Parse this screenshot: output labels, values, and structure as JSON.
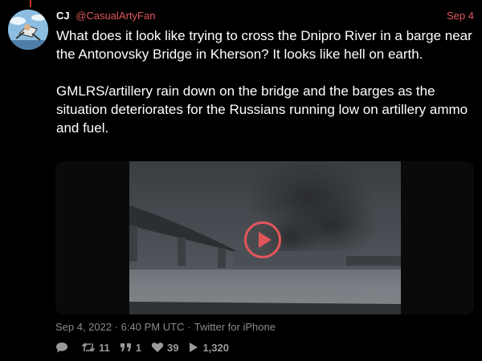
{
  "tweet": {
    "author_name": "CJ",
    "handle": "@CasualArtyFan",
    "date": "Sep 4",
    "text": "What does it look like trying to cross the Dnipro River in a barge near the Antonovsky Bridge in Kherson? It looks like hell on earth.\n\nGMLRS/artillery rain down on the bridge and the barges as the situation deteriorates for the Russians running low on artillery ammo and fuel.",
    "timestamp": "Sep 4, 2022 · 6:40 PM UTC",
    "source": "Twitter for iPhone"
  },
  "media": {
    "type": "video",
    "play_icon": "play-icon"
  },
  "stats": {
    "replies": "",
    "retweets": "11",
    "quotes": "1",
    "likes": "39",
    "views": "1,320"
  },
  "colors": {
    "accent": "#e0565b",
    "background": "#000000",
    "muted": "#8b8b8b"
  }
}
